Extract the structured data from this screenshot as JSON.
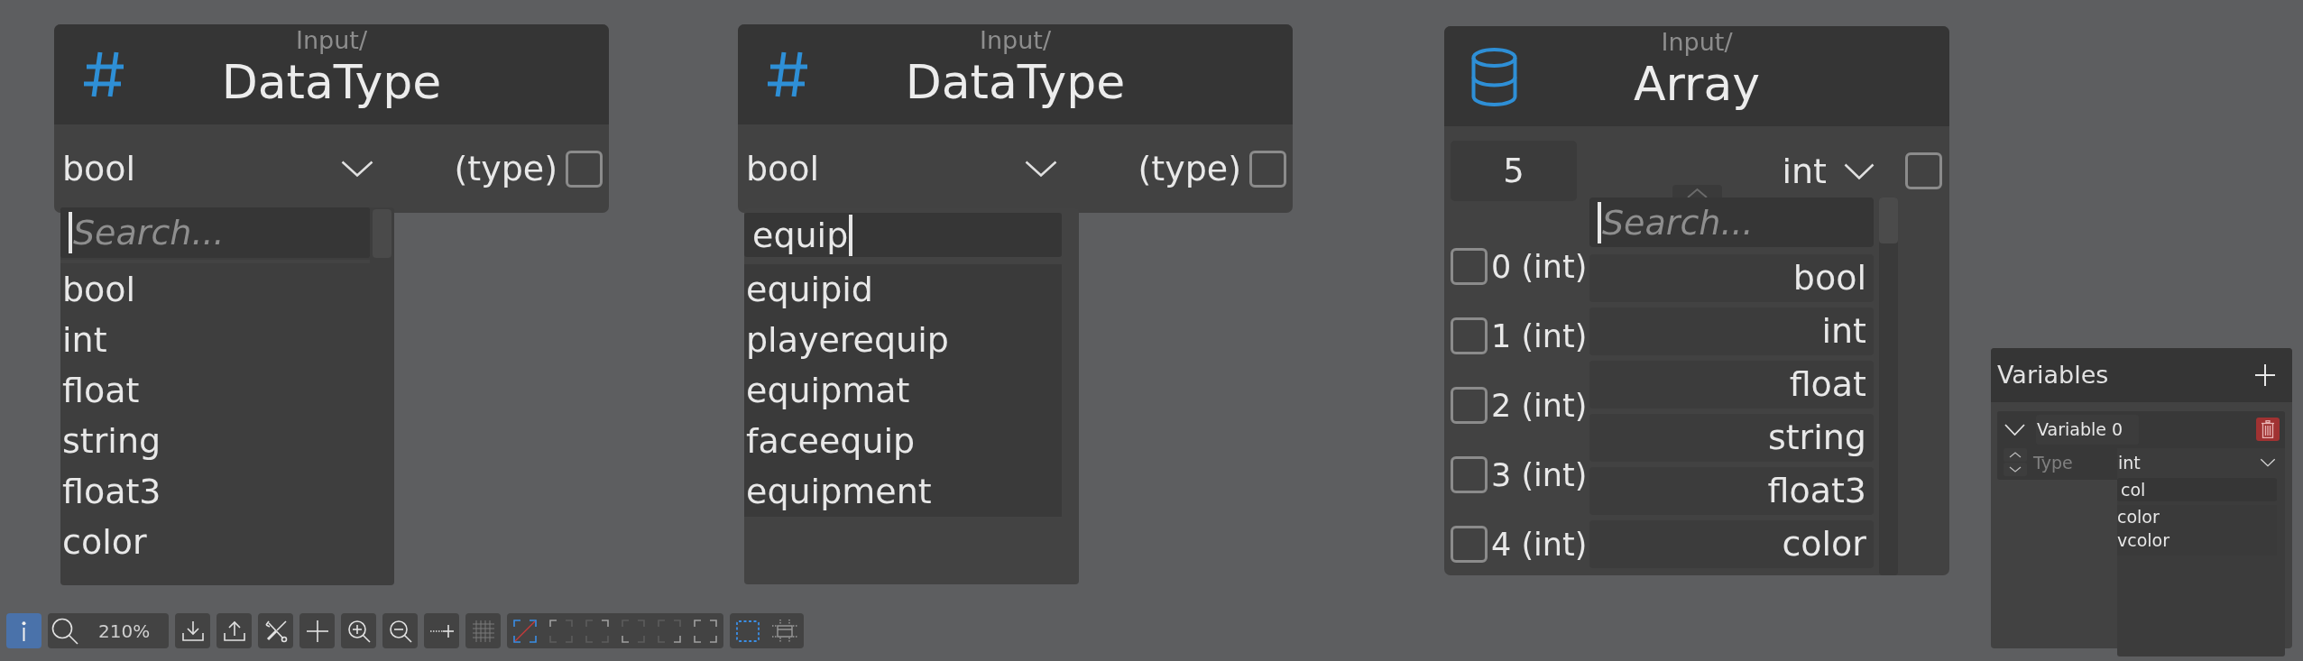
{
  "nodes": [
    {
      "kind": "datatype",
      "category": "Input/",
      "title": "DataType",
      "select": {
        "value": "bool"
      },
      "type_label": "(type)",
      "checked": false,
      "dropdown": {
        "search": {
          "placeholder": "Search...",
          "focused": true
        },
        "options": [
          "bool",
          "int",
          "float",
          "string",
          "float3",
          "color"
        ]
      }
    },
    {
      "kind": "datatype",
      "category": "Input/",
      "title": "DataType",
      "select": {
        "value": "bool"
      },
      "type_label": "(type)",
      "checked": false,
      "dropdown": {
        "search": {
          "value": "equip",
          "focused": true
        },
        "options": [
          "equipid",
          "playerequip",
          "equipmat",
          "faceequip",
          "equipment"
        ]
      }
    },
    {
      "kind": "array",
      "category": "Input/",
      "title": "Array",
      "count": "5",
      "select": {
        "value": "int"
      },
      "checked": false,
      "elements": [
        {
          "label": "0 (int)",
          "checked": false
        },
        {
          "label": "1 (int)",
          "checked": false
        },
        {
          "label": "2 (int)",
          "checked": false
        },
        {
          "label": "3 (int)",
          "checked": false
        },
        {
          "label": "4 (int)",
          "checked": false
        }
      ],
      "dropdown": {
        "search": {
          "placeholder": "Search...",
          "focused": true
        },
        "options": [
          "bool",
          "int",
          "float",
          "string",
          "float3",
          "color"
        ]
      }
    }
  ],
  "variables_panel": {
    "title": "Variables",
    "variables": [
      {
        "name": "Variable 0",
        "expanded": true,
        "type_label": "Type",
        "type": {
          "value": "int"
        },
        "dropdown": {
          "search": {
            "value": "col",
            "focused": false
          },
          "options": [
            "color",
            "vcolor"
          ]
        }
      }
    ]
  },
  "toolbar": {
    "info": {
      "on": true
    },
    "zoom": "210%",
    "frame_modes": [
      {
        "selected": true
      },
      {
        "selected": false
      },
      {
        "selected": false
      },
      {
        "selected": false
      },
      {
        "selected": false
      },
      {
        "selected": false
      }
    ],
    "view_modes": [
      {
        "selected": true
      },
      {
        "selected": false
      }
    ]
  }
}
